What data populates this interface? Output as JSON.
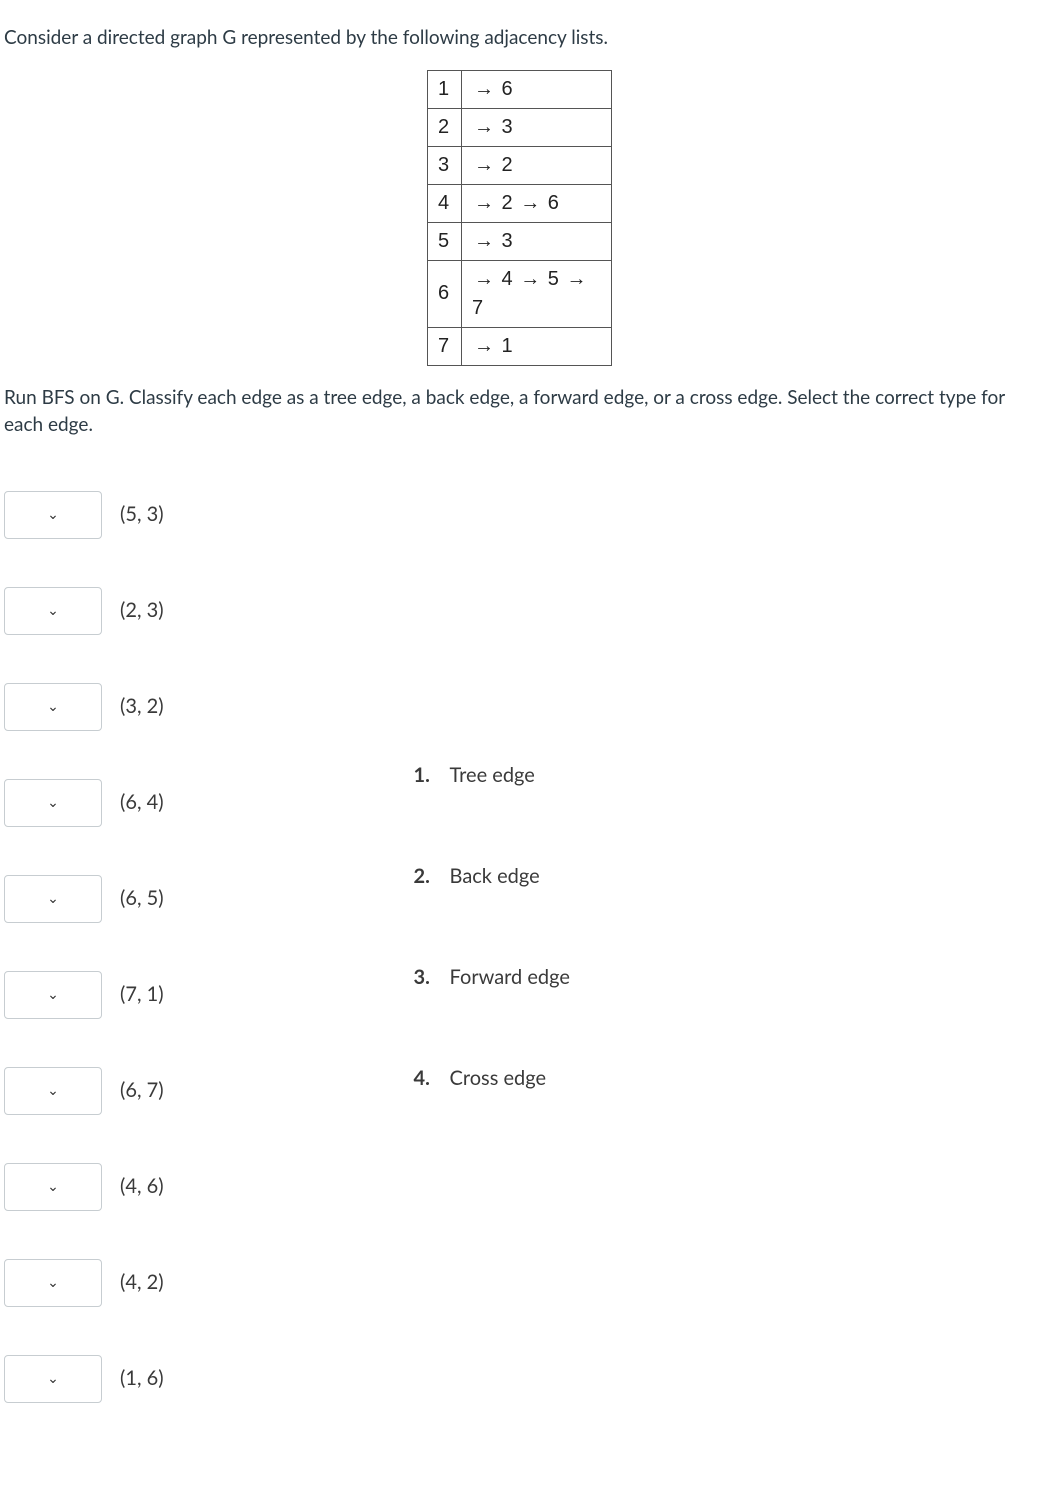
{
  "question": {
    "intro": "Consider a directed graph G represented by the following adjacency lists.",
    "adjacency": [
      {
        "key": "1",
        "vals": [
          "6"
        ]
      },
      {
        "key": "2",
        "vals": [
          "3"
        ]
      },
      {
        "key": "3",
        "vals": [
          "2"
        ]
      },
      {
        "key": "4",
        "vals": [
          "2",
          "6"
        ]
      },
      {
        "key": "5",
        "vals": [
          "3"
        ]
      },
      {
        "key": "6",
        "vals": [
          "4",
          "5",
          "7"
        ]
      },
      {
        "key": "7",
        "vals": [
          "1"
        ]
      }
    ],
    "instruction": "Run BFS on G. Classify each edge as a tree edge, a back edge, a forward edge, or a cross edge. Select the correct type for each edge."
  },
  "matching": {
    "edges": [
      "(5, 3)",
      "(2, 3)",
      "(3, 2)",
      "(6, 4)",
      "(6, 5)",
      "(7, 1)",
      "(6, 7)",
      "(4, 6)",
      "(4, 2)",
      "(1, 6)"
    ],
    "options": [
      {
        "num": "1.",
        "label": "Tree edge"
      },
      {
        "num": "2.",
        "label": "Back edge"
      },
      {
        "num": "3.",
        "label": "Forward edge"
      },
      {
        "num": "4.",
        "label": "Cross edge"
      }
    ]
  },
  "glyphs": {
    "arrow": "→",
    "chevron": "⌄"
  }
}
